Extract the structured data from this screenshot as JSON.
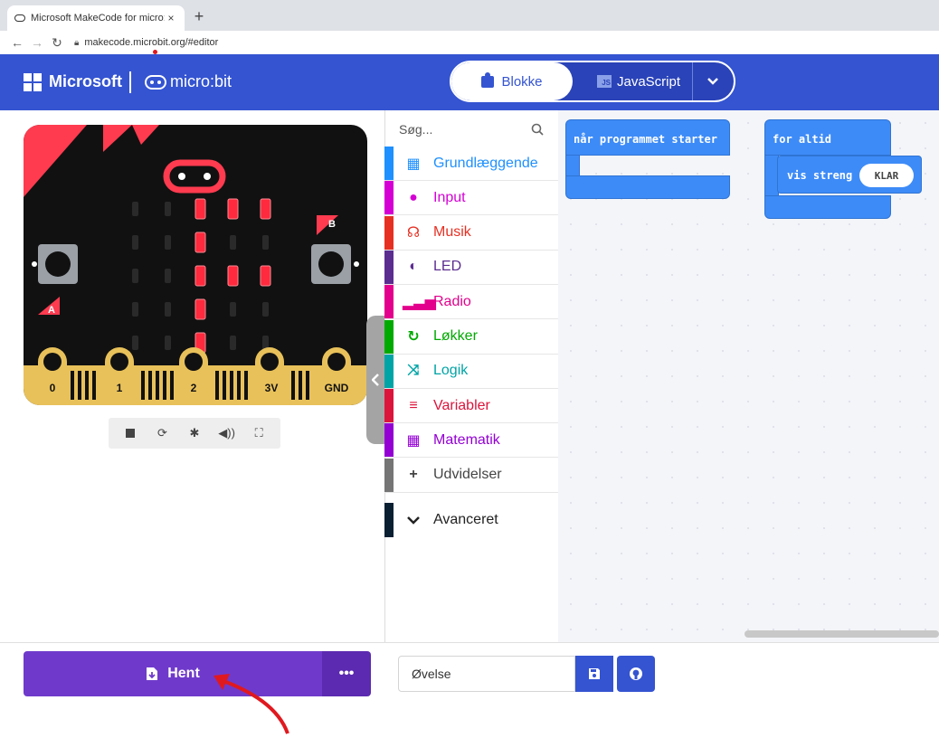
{
  "browser": {
    "tab_title": "Microsoft MakeCode for micro:bit",
    "tab_close": "×",
    "new_tab": "+",
    "url": "makecode.microbit.org/#editor"
  },
  "header": {
    "microsoft_label": "Microsoft",
    "microbit_label": "micro:bit",
    "blocks_label": "Blokke",
    "javascript_label": "JavaScript",
    "js_badge": "JS",
    "dropdown_chevron": "⌄"
  },
  "simulator": {
    "pin_labels": [
      "0",
      "1",
      "2",
      "3V",
      "GND"
    ],
    "button_a": "A",
    "button_b": "B",
    "led_rows": [
      [
        0,
        0,
        1,
        1,
        1
      ],
      [
        0,
        0,
        1,
        0,
        0
      ],
      [
        0,
        0,
        1,
        1,
        1
      ],
      [
        0,
        0,
        1,
        0,
        0
      ],
      [
        0,
        0,
        1,
        0,
        0
      ]
    ],
    "controls": [
      "stop-icon",
      "restart-icon",
      "debug-icon",
      "mute-icon",
      "fullscreen-icon"
    ]
  },
  "toolbox": {
    "search_placeholder": "Søg...",
    "categories": [
      {
        "label": "Grundlæggende",
        "color": "#1e90ff",
        "icon": "▦"
      },
      {
        "label": "Input",
        "color": "#d400d4",
        "icon": "●"
      },
      {
        "label": "Musik",
        "color": "#e63022",
        "icon": "☊"
      },
      {
        "label": "LED",
        "color": "#5c2d91",
        "icon": "◐"
      },
      {
        "label": "Radio",
        "color": "#e3008c",
        "icon": "▂▃▅"
      },
      {
        "label": "Løkker",
        "color": "#00aa00",
        "icon": "↻"
      },
      {
        "label": "Logik",
        "color": "#00a4a6",
        "icon": "⤨"
      },
      {
        "label": "Variabler",
        "color": "#dc143c",
        "icon": "≡"
      },
      {
        "label": "Matematik",
        "color": "#9400d3",
        "icon": "▦"
      },
      {
        "label": "Udvidelser",
        "color": "#757575",
        "icon": "+"
      }
    ],
    "advanced_label": "Avanceret"
  },
  "workspace": {
    "on_start_label": "når programmet starter",
    "forever_label": "for altid",
    "show_string_label": "vis streng",
    "string_value": "KLAR"
  },
  "bottom": {
    "download_label": "Hent",
    "more_label": "•••",
    "project_name": "Øvelse"
  },
  "colors": {
    "header": "#3454d1",
    "download": "#6f3acb",
    "block": "#3d8bf7",
    "led_on": "#ff2a3d",
    "annotation_arrow": "#e0191f"
  }
}
